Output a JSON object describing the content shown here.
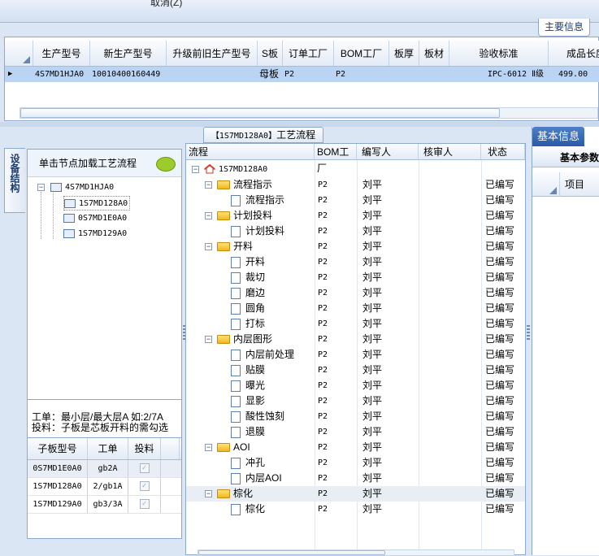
{
  "top": {
    "cancel_label": "取消(Z)",
    "main_info_tab": "主要信息"
  },
  "grid1": {
    "columns": [
      "生产型号",
      "新生产型号",
      "升级前旧生产型号",
      "S板",
      "订单工厂",
      "BOM工厂",
      "板厚",
      "板材",
      "验收标准",
      "成品长度"
    ],
    "row": [
      "4S7MD1HJA0",
      "10010400160449",
      "",
      "母板",
      "P2",
      "P2",
      "",
      "",
      "IPC-6012 Ⅱ级",
      "499.00"
    ]
  },
  "left": {
    "side_tab": "设备结构",
    "hint": "单击节点加载工艺流程",
    "tree": {
      "root": "4S7MD1HJA0",
      "children": [
        "1S7MD128A0",
        "0S7MD1E0A0",
        "1S7MD129A0"
      ]
    },
    "note_line1": "工单：最小层/最大层A 如:2/7A",
    "note_line2": "投料：子板是芯板开料的需勾选",
    "subgrid": {
      "headers": [
        "子板型号",
        "工单",
        "投料"
      ],
      "rows": [
        {
          "model": "0S7MD1E0A0",
          "order": "gb2A",
          "feed": "✓"
        },
        {
          "model": "1S7MD128A0",
          "order": "2/gb1A",
          "feed": "✓"
        },
        {
          "model": "1S7MD129A0",
          "order": "gb3/3A",
          "feed": "✓"
        }
      ]
    }
  },
  "middle": {
    "title_code": "【1S7MD128A0】",
    "title_text": "工艺流程",
    "headers": [
      "流程",
      "BOM工厂",
      "编写人",
      "核审人",
      "状态"
    ],
    "root": "1S7MD128A0",
    "rows": [
      {
        "name": "流程指示",
        "bom": "P2",
        "author": "刘平",
        "status": "已编写"
      },
      {
        "name": "流程指示",
        "bom": "P2",
        "author": "刘平",
        "status": "已编写"
      },
      {
        "name": "计划投料",
        "bom": "P2",
        "author": "刘平",
        "status": "已编写"
      },
      {
        "name": "计划投料",
        "bom": "P2",
        "author": "刘平",
        "status": "已编写"
      },
      {
        "name": "开料",
        "bom": "P2",
        "author": "刘平",
        "status": "已编写"
      },
      {
        "name": "开料",
        "bom": "P2",
        "author": "刘平",
        "status": "已编写"
      },
      {
        "name": "裁切",
        "bom": "P2",
        "author": "刘平",
        "status": "已编写"
      },
      {
        "name": "磨边",
        "bom": "P2",
        "author": "刘平",
        "status": "已编写"
      },
      {
        "name": "圆角",
        "bom": "P2",
        "author": "刘平",
        "status": "已编写"
      },
      {
        "name": "打标",
        "bom": "P2",
        "author": "刘平",
        "status": "已编写"
      },
      {
        "name": "内层图形",
        "bom": "P2",
        "author": "刘平",
        "status": "已编写"
      },
      {
        "name": "内层前处理",
        "bom": "P2",
        "author": "刘平",
        "status": "已编写"
      },
      {
        "name": "贴膜",
        "bom": "P2",
        "author": "刘平",
        "status": "已编写"
      },
      {
        "name": "曝光",
        "bom": "P2",
        "author": "刘平",
        "status": "已编写"
      },
      {
        "name": "显影",
        "bom": "P2",
        "author": "刘平",
        "status": "已编写"
      },
      {
        "name": "酸性蚀刻",
        "bom": "P2",
        "author": "刘平",
        "status": "已编写"
      },
      {
        "name": "退膜",
        "bom": "P2",
        "author": "刘平",
        "status": "已编写"
      },
      {
        "name": "AOI",
        "bom": "P2",
        "author": "刘平",
        "status": "已编写"
      },
      {
        "name": "冲孔",
        "bom": "P2",
        "author": "刘平",
        "status": "已编写"
      },
      {
        "name": "内层AOI",
        "bom": "P2",
        "author": "刘平",
        "status": "已编写"
      },
      {
        "name": "棕化",
        "bom": "P2",
        "author": "刘平",
        "status": "已编写"
      },
      {
        "name": "棕化",
        "bom": "P2",
        "author": "刘平",
        "status": "已编写"
      }
    ]
  },
  "right": {
    "tab": "基本信息",
    "sub": "基本参数",
    "col": "项目"
  }
}
